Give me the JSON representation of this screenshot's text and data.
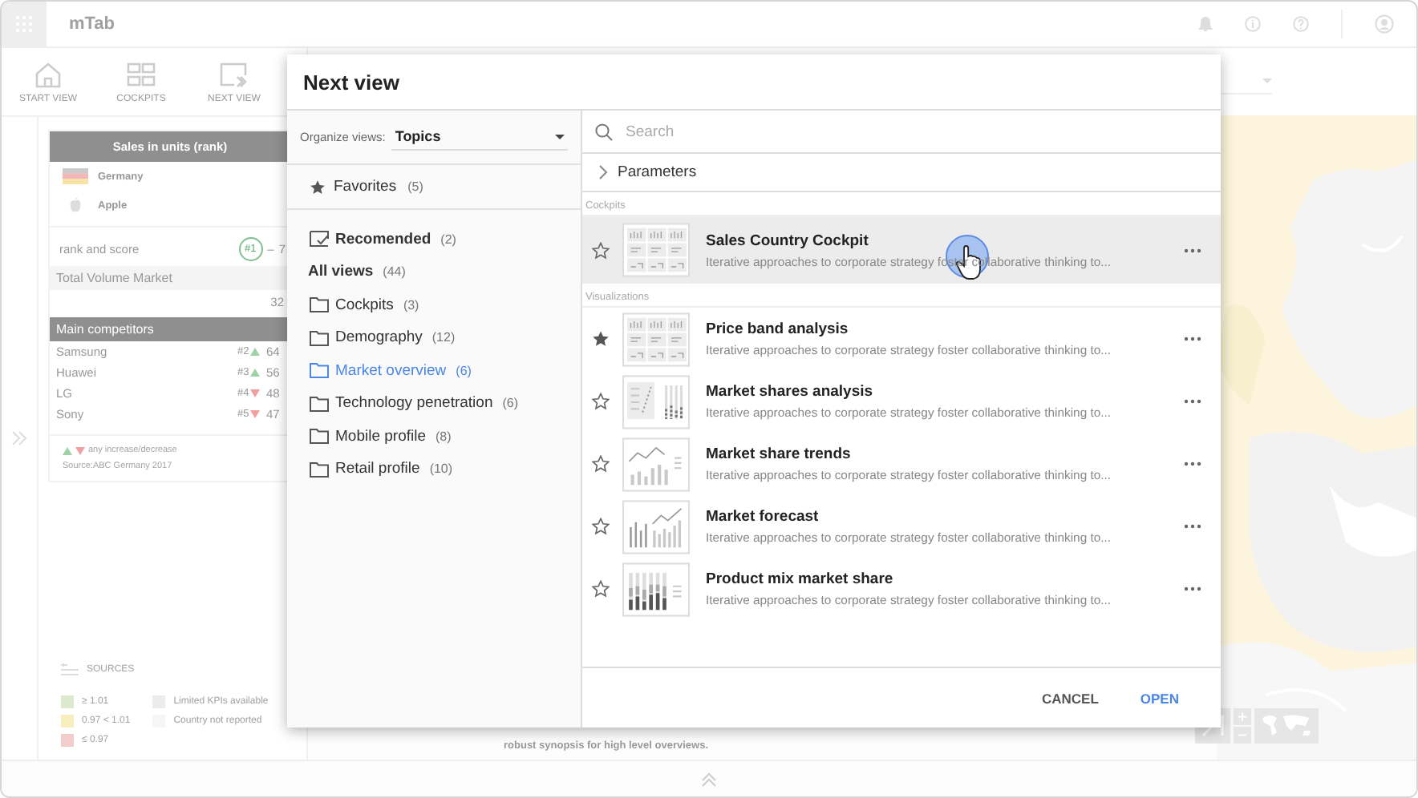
{
  "app": {
    "title": "mTab"
  },
  "toolbar": [
    {
      "label": "START VIEW",
      "kind": "home"
    },
    {
      "label": "COCKPITS",
      "kind": "grid"
    },
    {
      "label": "NEXT VIEW",
      "kind": "next"
    }
  ],
  "card": {
    "title": "Sales in units (rank)",
    "filters": [
      {
        "label": "Germany",
        "kind": "flag"
      },
      {
        "label": "Apple",
        "kind": "brand"
      }
    ],
    "rank_label": "rank and score",
    "rank": "#1",
    "rank_dash": "–",
    "rank_value": "7",
    "total_label": "Total Volume Market",
    "total_value": "32",
    "competitors_title": "Main competitors",
    "competitors": [
      {
        "name": "Samsung",
        "rank": "#2",
        "kind": "up",
        "value": "64"
      },
      {
        "name": "Huawei",
        "rank": "#3",
        "kind": "up",
        "value": "56"
      },
      {
        "name": "LG",
        "rank": "#4",
        "kind": "down",
        "value": "48"
      },
      {
        "name": "Sony",
        "rank": "#5",
        "kind": "down",
        "value": "47"
      }
    ],
    "trend_note": "any increase/decrease",
    "source": "Source:ABC Germany 2017"
  },
  "sources_label": "SOURCES",
  "legend": [
    {
      "label": "≥ 1.01",
      "color": "#dbe9cf"
    },
    {
      "label": "0.97 < 1.01",
      "color": "#f7efc0"
    },
    {
      "label": "≤ 0.97",
      "color": "#f3cccc"
    }
  ],
  "availability": [
    {
      "label": "Limited KPIs available",
      "color": "#ececec"
    },
    {
      "label": "Country not reported",
      "color": "#f6f6f6"
    }
  ],
  "footnote": "robust synopsis for high level overviews.",
  "dialog": {
    "title": "Next view",
    "organize_label": "Organize views:",
    "organize_value": "Topics",
    "favorites": {
      "label": "Favorites",
      "count": "(5)"
    },
    "topics": [
      {
        "label": "Recomended",
        "count": "(2)",
        "kind": "recommended",
        "selected": false
      },
      {
        "label": "All views",
        "count": "(44)",
        "kind": "all",
        "selected": false
      },
      {
        "label": "Cockpits",
        "count": "(3)",
        "kind": "folder",
        "selected": false
      },
      {
        "label": "Demography",
        "count": "(12)",
        "kind": "folder",
        "selected": false
      },
      {
        "label": "Market overview",
        "count": "(6)",
        "kind": "folder",
        "selected": true
      },
      {
        "label": "Technology penetration",
        "count": "(6)",
        "kind": "folder",
        "selected": false
      },
      {
        "label": "Mobile profile",
        "count": "(8)",
        "kind": "folder",
        "selected": false
      },
      {
        "label": "Retail profile",
        "count": "(10)",
        "kind": "folder",
        "selected": false
      }
    ],
    "search_placeholder": "Search",
    "parameters": {
      "label": "Parameters",
      "expanded": false
    },
    "sections": [
      {
        "title": "Cockpits",
        "items": [
          {
            "title": "Sales Country Cockpit",
            "description": "Iterative approaches to corporate strategy foster collaborative thinking to...",
            "kind": "table",
            "favorite": false,
            "highlighted": true
          }
        ]
      },
      {
        "title": "Visualizations",
        "items": [
          {
            "title": "Price band analysis",
            "description": "Iterative approaches to corporate strategy foster collaborative thinking to...",
            "kind": "table",
            "favorite": true,
            "highlighted": false
          },
          {
            "title": "Market shares analysis",
            "description": "Iterative approaches to corporate strategy foster collaborative thinking to...",
            "kind": "scatter",
            "favorite": false,
            "highlighted": false
          },
          {
            "title": "Market share trends",
            "description": "Iterative approaches to corporate strategy foster collaborative thinking to...",
            "kind": "trend",
            "favorite": false,
            "highlighted": false
          },
          {
            "title": "Market forecast",
            "description": "Iterative approaches to corporate strategy foster collaborative thinking to...",
            "kind": "forecast",
            "favorite": false,
            "highlighted": false
          },
          {
            "title": "Product mix market share",
            "description": "Iterative approaches to corporate strategy foster collaborative thinking to...",
            "kind": "stacked",
            "favorite": false,
            "highlighted": false
          }
        ]
      }
    ],
    "buttons": [
      {
        "label": "CANCEL",
        "kind": "secondary"
      },
      {
        "label": "OPEN",
        "kind": "primary"
      }
    ]
  }
}
